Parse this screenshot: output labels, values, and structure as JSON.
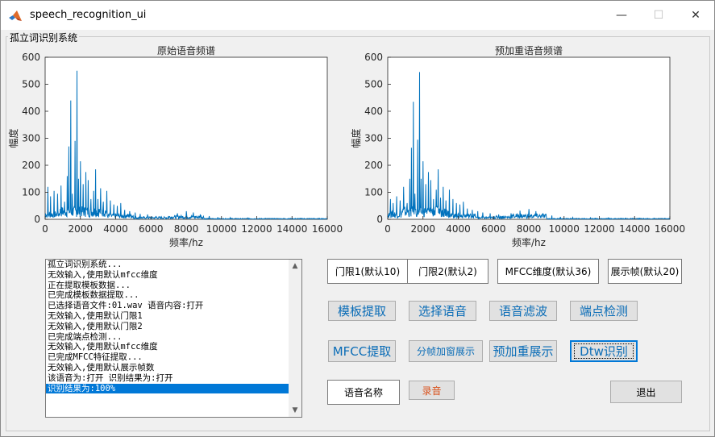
{
  "window": {
    "title": "speech_recognition_ui",
    "min_glyph": "—",
    "max_glyph": "☐",
    "close_glyph": "✕"
  },
  "panel": {
    "title": "孤立词识别系统"
  },
  "charts": {
    "left_title": "原始语音频谱",
    "right_title": "预加重语音频谱"
  },
  "chart_data": [
    {
      "type": "line",
      "title": "原始语音频谱",
      "xlabel": "频率/hz",
      "ylabel": "幅度",
      "xlim": [
        0,
        16000
      ],
      "ylim": [
        0,
        600
      ],
      "xticks": [
        0,
        2000,
        4000,
        6000,
        8000,
        10000,
        12000,
        14000,
        16000
      ],
      "yticks": [
        0,
        100,
        200,
        300,
        400,
        500,
        600
      ],
      "grid": false,
      "color": "#0072bd",
      "peaks": [
        {
          "x": 150,
          "y": 120
        },
        {
          "x": 300,
          "y": 85
        },
        {
          "x": 500,
          "y": 105
        },
        {
          "x": 700,
          "y": 95
        },
        {
          "x": 900,
          "y": 125
        },
        {
          "x": 1100,
          "y": 65
        },
        {
          "x": 1250,
          "y": 160
        },
        {
          "x": 1350,
          "y": 270
        },
        {
          "x": 1450,
          "y": 440
        },
        {
          "x": 1550,
          "y": 95
        },
        {
          "x": 1700,
          "y": 290
        },
        {
          "x": 1800,
          "y": 550
        },
        {
          "x": 1900,
          "y": 150
        },
        {
          "x": 2000,
          "y": 215
        },
        {
          "x": 2150,
          "y": 130
        },
        {
          "x": 2300,
          "y": 175
        },
        {
          "x": 2450,
          "y": 145
        },
        {
          "x": 2600,
          "y": 75
        },
        {
          "x": 2750,
          "y": 105
        },
        {
          "x": 2850,
          "y": 185
        },
        {
          "x": 3000,
          "y": 75
        },
        {
          "x": 3150,
          "y": 115
        },
        {
          "x": 3300,
          "y": 65
        },
        {
          "x": 3500,
          "y": 105
        },
        {
          "x": 3700,
          "y": 70
        },
        {
          "x": 3900,
          "y": 55
        },
        {
          "x": 4100,
          "y": 50
        },
        {
          "x": 4300,
          "y": 60
        },
        {
          "x": 4500,
          "y": 35
        },
        {
          "x": 4800,
          "y": 30
        },
        {
          "x": 5100,
          "y": 25
        },
        {
          "x": 5400,
          "y": 20
        },
        {
          "x": 5800,
          "y": 18
        },
        {
          "x": 6300,
          "y": 12
        },
        {
          "x": 7000,
          "y": 12
        },
        {
          "x": 7500,
          "y": 22
        },
        {
          "x": 8000,
          "y": 30
        },
        {
          "x": 8400,
          "y": 25
        },
        {
          "x": 8800,
          "y": 18
        },
        {
          "x": 9300,
          "y": 12
        },
        {
          "x": 9800,
          "y": 8
        },
        {
          "x": 10500,
          "y": 6
        },
        {
          "x": 11500,
          "y": 5
        },
        {
          "x": 12500,
          "y": 4
        },
        {
          "x": 13500,
          "y": 3
        },
        {
          "x": 14500,
          "y": 3
        },
        {
          "x": 15500,
          "y": 2
        }
      ]
    },
    {
      "type": "line",
      "title": "预加重语音频谱",
      "xlabel": "频率/hz",
      "ylabel": "幅度",
      "xlim": [
        0,
        16000
      ],
      "ylim": [
        0,
        600
      ],
      "xticks": [
        0,
        2000,
        4000,
        6000,
        8000,
        10000,
        12000,
        14000,
        16000
      ],
      "yticks": [
        0,
        100,
        200,
        300,
        400,
        500,
        600
      ],
      "grid": false,
      "color": "#0072bd",
      "peaks": [
        {
          "x": 150,
          "y": 75
        },
        {
          "x": 300,
          "y": 60
        },
        {
          "x": 500,
          "y": 85
        },
        {
          "x": 700,
          "y": 70
        },
        {
          "x": 900,
          "y": 120
        },
        {
          "x": 1100,
          "y": 60
        },
        {
          "x": 1250,
          "y": 150
        },
        {
          "x": 1350,
          "y": 265
        },
        {
          "x": 1450,
          "y": 435
        },
        {
          "x": 1550,
          "y": 95
        },
        {
          "x": 1700,
          "y": 295
        },
        {
          "x": 1800,
          "y": 545
        },
        {
          "x": 1900,
          "y": 150
        },
        {
          "x": 2000,
          "y": 215
        },
        {
          "x": 2150,
          "y": 130
        },
        {
          "x": 2300,
          "y": 175
        },
        {
          "x": 2450,
          "y": 145
        },
        {
          "x": 2600,
          "y": 75
        },
        {
          "x": 2750,
          "y": 110
        },
        {
          "x": 2850,
          "y": 185
        },
        {
          "x": 3000,
          "y": 80
        },
        {
          "x": 3150,
          "y": 120
        },
        {
          "x": 3300,
          "y": 70
        },
        {
          "x": 3500,
          "y": 110
        },
        {
          "x": 3700,
          "y": 75
        },
        {
          "x": 3900,
          "y": 60
        },
        {
          "x": 4100,
          "y": 55
        },
        {
          "x": 4300,
          "y": 65
        },
        {
          "x": 4500,
          "y": 40
        },
        {
          "x": 4800,
          "y": 35
        },
        {
          "x": 5100,
          "y": 30
        },
        {
          "x": 5400,
          "y": 25
        },
        {
          "x": 5800,
          "y": 22
        },
        {
          "x": 6300,
          "y": 18
        },
        {
          "x": 7000,
          "y": 22
        },
        {
          "x": 7500,
          "y": 32
        },
        {
          "x": 8000,
          "y": 38
        },
        {
          "x": 8400,
          "y": 30
        },
        {
          "x": 8800,
          "y": 22
        },
        {
          "x": 9300,
          "y": 14
        },
        {
          "x": 9800,
          "y": 9
        },
        {
          "x": 10500,
          "y": 7
        },
        {
          "x": 11500,
          "y": 6
        },
        {
          "x": 12500,
          "y": 5
        },
        {
          "x": 13500,
          "y": 4
        },
        {
          "x": 14500,
          "y": 3
        },
        {
          "x": 15500,
          "y": 3
        }
      ]
    }
  ],
  "log": {
    "lines": [
      "孤立词识别系统...",
      "无效输入,使用默认mfcc维度",
      "正在提取模板数据...",
      "已完成模板数据提取...",
      "已选择语音文件:01.wav 语音内容:打开",
      "无效输入,使用默认门限1",
      "无效输入,使用默认门限2",
      "已完成端点检测...",
      "无效输入,使用默认mfcc维度",
      "已完成MFCC特征提取...",
      "无效输入,使用默认展示帧数",
      "该语音为:打开 识别结果为:打开",
      "识别结果为:100%"
    ],
    "selected_index": 12,
    "scroll_up_glyph": "▲",
    "scroll_down_glyph": "▼"
  },
  "inputs": {
    "threshold1": "门限1(默认10)",
    "threshold2": "门限2(默认2)",
    "mfcc_dim": "MFCC维度(默认36)",
    "show_frames": "展示帧(默认20)"
  },
  "buttons": {
    "template_extract": "模板提取",
    "select_voice": "选择语音",
    "voice_filter": "语音滤波",
    "endpoint_detect": "端点检测",
    "mfcc_extract": "MFCC提取",
    "frame_window_show": "分帧加窗展示",
    "preemphasis_show": "预加重展示",
    "dtw_recognize": "Dtw识别",
    "voice_name": "语音名称",
    "record": "录音",
    "exit": "退出"
  },
  "colors": {
    "accent_text": "#0b6db7",
    "record_text": "#d9531e",
    "selection": "#0078d7",
    "plot_line": "#0072bd"
  }
}
